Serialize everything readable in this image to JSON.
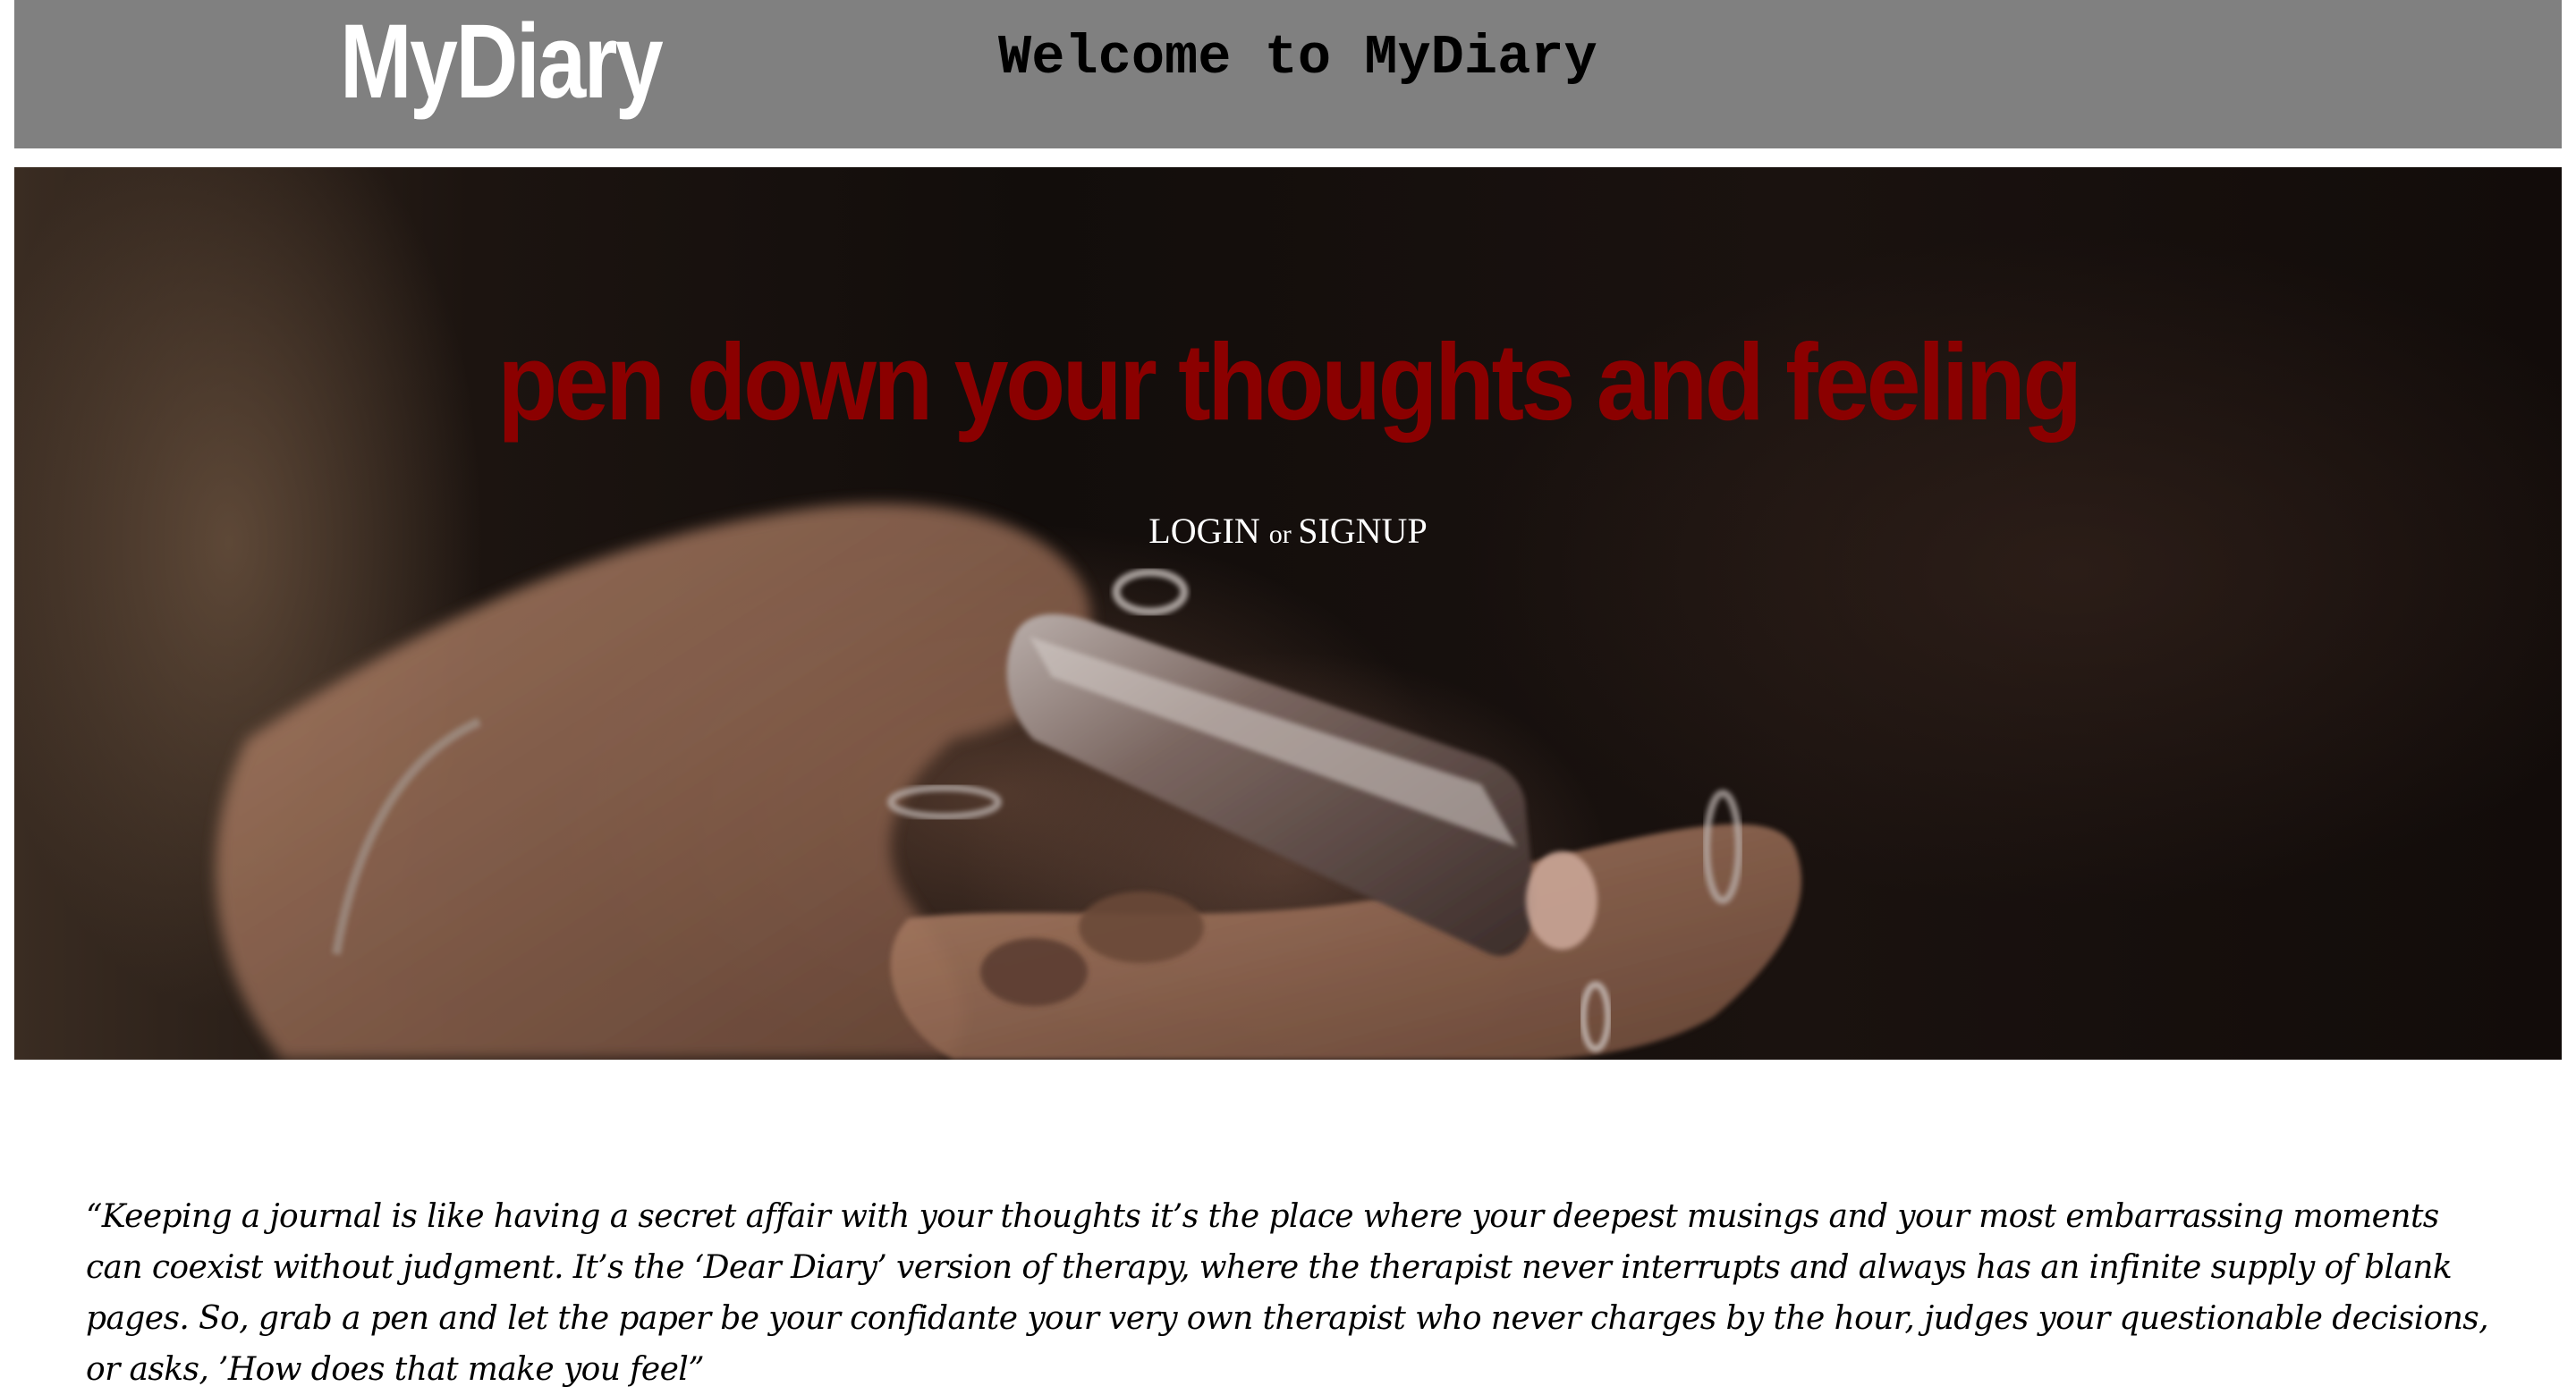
{
  "header": {
    "logo": "MyDiary",
    "welcome": "Welcome to MyDiary",
    "background_color": "#808080"
  },
  "hero": {
    "tagline": "pen down your thoughts and feeling",
    "tagline_color": "#8b0000",
    "login_label": "LOGIN",
    "or_label": "or",
    "signup_label": "SIGNUP",
    "image_subject": "hands-holding-phone-photo"
  },
  "quote": {
    "text": "“Keeping a journal is like having a secret affair with your thoughts it’s the place where your deepest musings and your most embarrassing moments can coexist without judgment. It’s the ‘Dear Diary’ version of therapy, where the therapist never interrupts and always has an infinite supply of blank pages. So, grab a pen and let the paper be your confidante your very own therapist who never charges by the hour, judges your questionable decisions, or asks, ’How does that make you feel”"
  }
}
